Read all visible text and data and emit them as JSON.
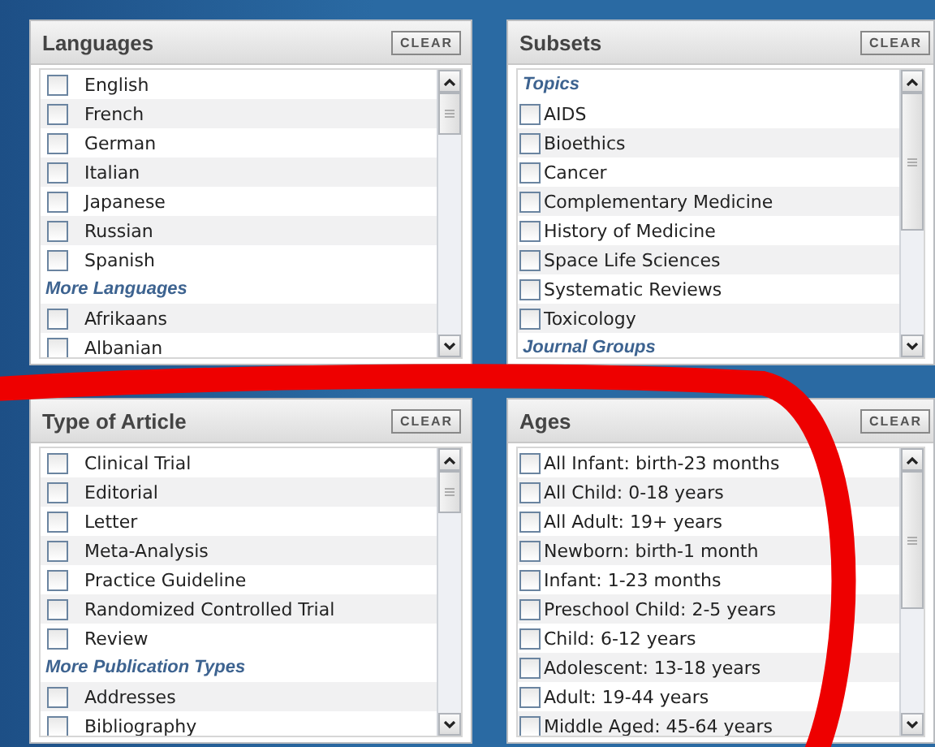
{
  "panels": [
    {
      "title": "Languages",
      "clear_label": "CLEAR",
      "items": [
        {
          "kind": "option",
          "label": "English",
          "checked": false
        },
        {
          "kind": "option",
          "label": "French",
          "checked": false
        },
        {
          "kind": "option",
          "label": "German",
          "checked": false
        },
        {
          "kind": "option",
          "label": "Italian",
          "checked": false
        },
        {
          "kind": "option",
          "label": "Japanese",
          "checked": false
        },
        {
          "kind": "option",
          "label": "Russian",
          "checked": false
        },
        {
          "kind": "option",
          "label": "Spanish",
          "checked": false
        },
        {
          "kind": "group",
          "label": "More Languages"
        },
        {
          "kind": "option",
          "label": "Afrikaans",
          "checked": false
        },
        {
          "kind": "option",
          "label": "Albanian",
          "checked": false
        }
      ]
    },
    {
      "title": "Subsets",
      "clear_label": "CLEAR",
      "items": [
        {
          "kind": "group",
          "label": "Topics"
        },
        {
          "kind": "option",
          "label": "AIDS",
          "checked": false
        },
        {
          "kind": "option",
          "label": "Bioethics",
          "checked": false
        },
        {
          "kind": "option",
          "label": "Cancer",
          "checked": false
        },
        {
          "kind": "option",
          "label": "Complementary Medicine",
          "checked": false
        },
        {
          "kind": "option",
          "label": "History of Medicine",
          "checked": false
        },
        {
          "kind": "option",
          "label": "Space Life Sciences",
          "checked": false
        },
        {
          "kind": "option",
          "label": "Systematic Reviews",
          "checked": false
        },
        {
          "kind": "option",
          "label": "Toxicology",
          "checked": false
        },
        {
          "kind": "group",
          "label": "Journal Groups"
        }
      ]
    },
    {
      "title": "Type of Article",
      "clear_label": "CLEAR",
      "items": [
        {
          "kind": "option",
          "label": "Clinical Trial",
          "checked": false
        },
        {
          "kind": "option",
          "label": "Editorial",
          "checked": false
        },
        {
          "kind": "option",
          "label": "Letter",
          "checked": false
        },
        {
          "kind": "option",
          "label": "Meta-Analysis",
          "checked": false
        },
        {
          "kind": "option",
          "label": "Practice Guideline",
          "checked": false
        },
        {
          "kind": "option",
          "label": "Randomized Controlled Trial",
          "checked": false
        },
        {
          "kind": "option",
          "label": "Review",
          "checked": false
        },
        {
          "kind": "group",
          "label": "More Publication Types"
        },
        {
          "kind": "option",
          "label": "Addresses",
          "checked": false
        },
        {
          "kind": "option",
          "label": "Bibliography",
          "checked": false
        }
      ]
    },
    {
      "title": "Ages",
      "clear_label": "CLEAR",
      "items": [
        {
          "kind": "option",
          "label": "All Infant: birth-23 months",
          "checked": false
        },
        {
          "kind": "option",
          "label": "All Child: 0-18 years",
          "checked": false
        },
        {
          "kind": "option",
          "label": "All Adult: 19+ years",
          "checked": false
        },
        {
          "kind": "option",
          "label": "Newborn: birth-1 month",
          "checked": false
        },
        {
          "kind": "option",
          "label": "Infant: 1-23 months",
          "checked": false
        },
        {
          "kind": "option",
          "label": "Preschool Child: 2-5 years",
          "checked": false
        },
        {
          "kind": "option",
          "label": "Child: 6-12 years",
          "checked": false
        },
        {
          "kind": "option",
          "label": "Adolescent: 13-18 years",
          "checked": false
        },
        {
          "kind": "option",
          "label": "Adult: 19-44 years",
          "checked": false
        },
        {
          "kind": "option",
          "label": "Middle Aged: 45-64 years",
          "checked": false
        }
      ]
    }
  ]
}
